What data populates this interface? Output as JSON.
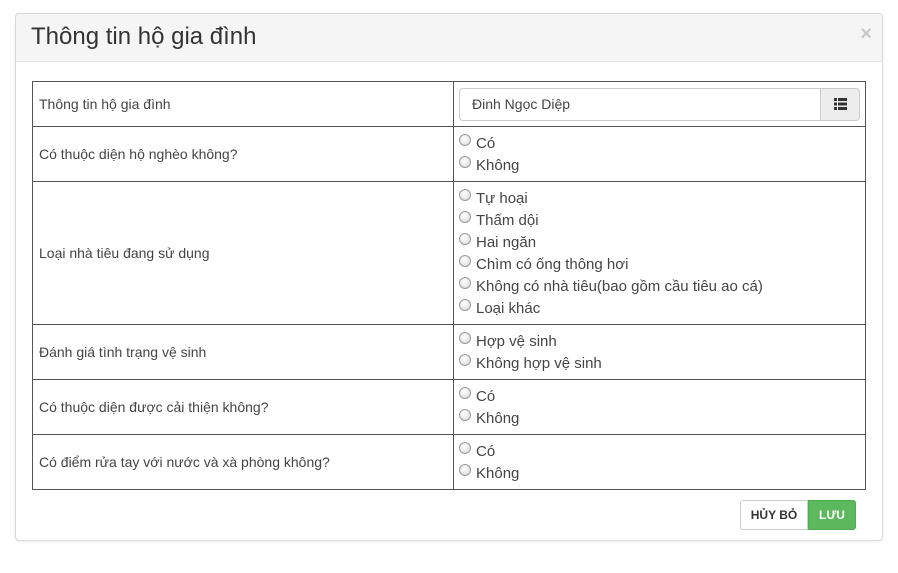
{
  "modal": {
    "title": "Thông tin hộ gia đình",
    "close_label": "×"
  },
  "rows": [
    {
      "label": "Thông tin hộ gia đình",
      "input_value": "Đinh Ngọc Diệp"
    },
    {
      "label": "Có thuộc diện hộ nghèo không?",
      "options": [
        "Có",
        "Không"
      ]
    },
    {
      "label": "Loại nhà tiêu đang sử dụng",
      "options": [
        "Tự hoại",
        "Thấm dội",
        "Hai ngăn",
        "Chìm có ống thông hơi",
        "Không có nhà tiêu(bao gồm cầu tiêu ao cá)",
        "Loại khác"
      ]
    },
    {
      "label": "Đánh giá tình trạng vệ sinh",
      "options": [
        "Hợp vệ sinh",
        "Không hợp vệ sinh"
      ]
    },
    {
      "label": "Có thuộc diện được cải thiện không?",
      "options": [
        "Có",
        "Không"
      ]
    },
    {
      "label": "Có điểm rửa tay với nước và xà phòng không?",
      "options": [
        "Có",
        "Không"
      ]
    }
  ],
  "footer": {
    "cancel_label": "HỦY BỎ",
    "save_label": "LƯU"
  },
  "icons": {
    "picker": "list-icon",
    "close": "close-icon"
  },
  "colors": {
    "save_button": "#5cb85c",
    "header_bg": "#f5f5f5"
  }
}
